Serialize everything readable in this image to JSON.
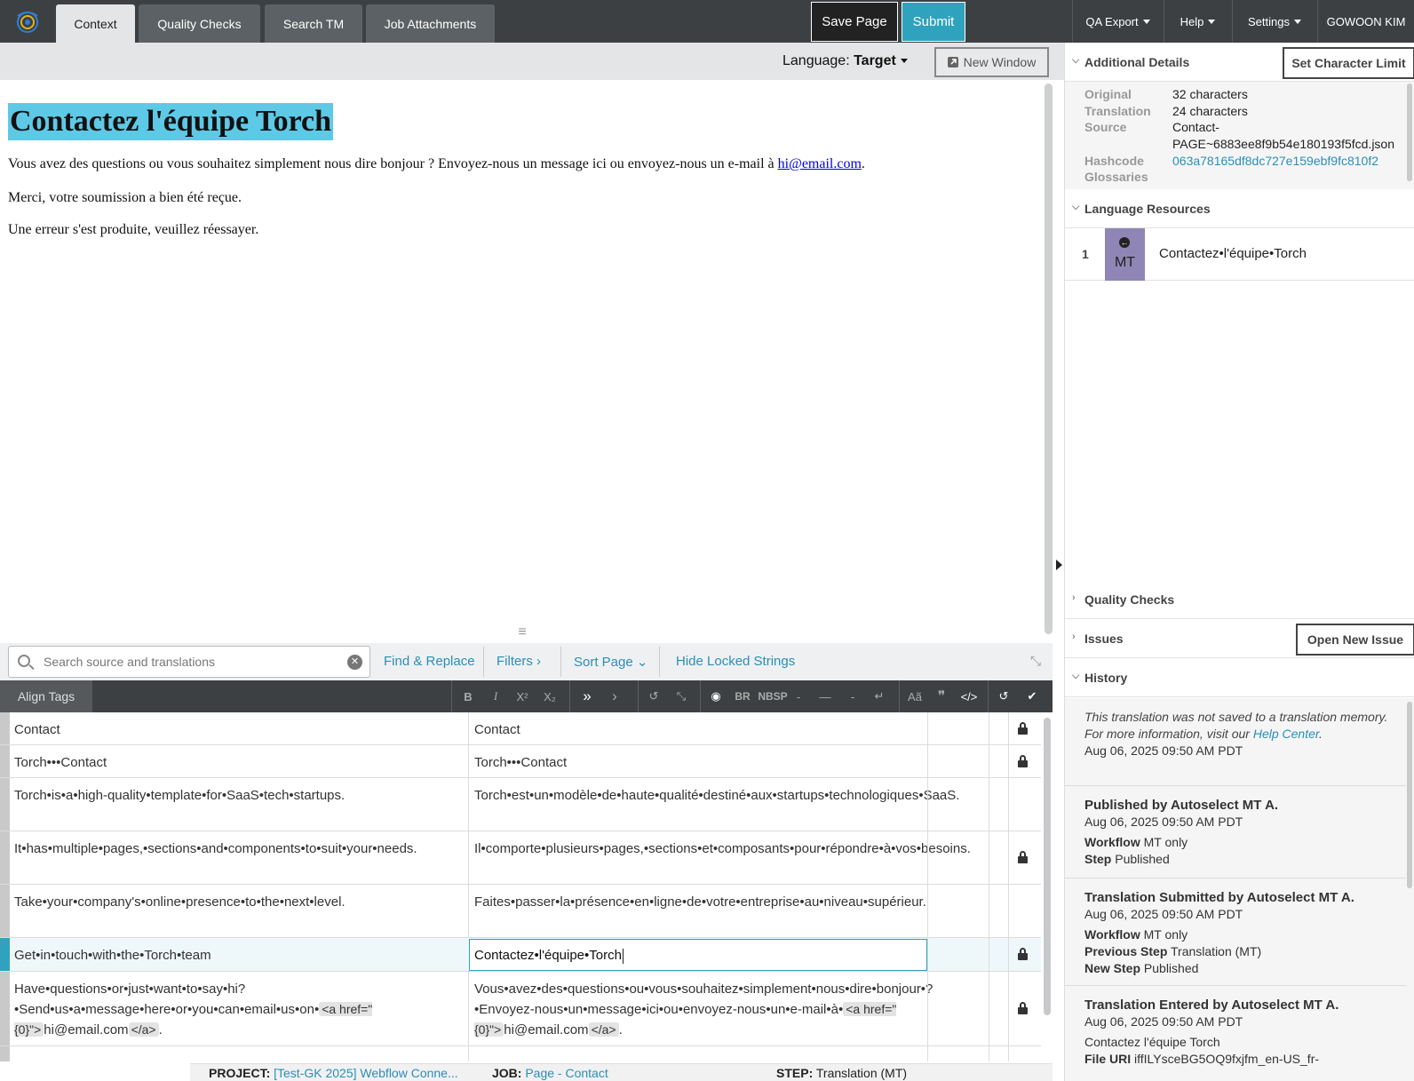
{
  "topbar": {
    "tabs": [
      "Context",
      "Quality Checks",
      "Search TM",
      "Job Attachments"
    ],
    "save_label": "Save Page",
    "submit_label": "Submit",
    "menus": [
      "QA Export",
      "Help",
      "Settings",
      "GOWOON KIM"
    ]
  },
  "preview": {
    "language_label": "Language:",
    "language_value": "Target",
    "new_window_label": "New Window",
    "heading": "Contactez l'équipe Torch",
    "p1_text": "Vous avez des questions ou vous souhaitez simplement nous dire bonjour ? Envoyez-nous un message ici ou envoyez-nous un e-mail à ",
    "p1_link": "hi@email.com",
    "p1_end": ".",
    "p2": "Merci, votre soumission a bien été reçue.",
    "p3": "Une erreur s'est produite, veuillez réessayer."
  },
  "search": {
    "placeholder": "Search source and translations",
    "find_replace": "Find & Replace",
    "filters": "Filters",
    "sort_page": "Sort Page",
    "hide_locked": "Hide Locked Strings"
  },
  "toolbar": {
    "align_tags": "Align Tags",
    "bold": "B",
    "italic": "I",
    "sup": "X²",
    "sub": "X₂",
    "br": "BR",
    "nbsp": "NBSP"
  },
  "grid": {
    "rows": [
      {
        "source": "Contact",
        "target": "Contact"
      },
      {
        "source": "Torch•••Contact",
        "target": "Torch•••Contact"
      },
      {
        "source": "Torch•is•a•high-quality•template•for•SaaS•tech•startups.",
        "target": "Torch•est•un•modèle•de•haute•qualité•destiné•aux•startups•technologiques•SaaS."
      },
      {
        "source": "It•has•multiple•pages,•sections•and•components•to•suit•your•needs.",
        "target": "Il•comporte•plusieurs•pages,•sections•et•composants•pour•répondre•à•vos•besoins."
      },
      {
        "source": "Take•your•company's•online•presence•to•the•next•level.",
        "target": "Faites•passer•la•présence•en•ligne•de•votre•entreprise•au•niveau•supérieur."
      },
      {
        "source": "Get•in•touch•with•the•Torch•team",
        "target": "Contactez•l'équipe•Torch"
      },
      {
        "source_a": "Have•questions•or•just•want•to•say•hi?•Send•us•a•message•here•or•you•can•email•us•on•",
        "source_tag1": "<a href=\"{0}\">",
        "source_b": "hi@email.com",
        "source_tag2": "</a>",
        "source_c": ".",
        "target_a": "Vous•avez•des•questions•ou•vous•souhaitez•simplement•nous•dire•bonjour•?•Envoyez-nous•un•message•ici•ou•envoyez-nous•un•e-mail•à•",
        "target_tag1": "<a href=\"{0}\">",
        "target_b": "hi@email.com",
        "target_tag2": "</a>",
        "target_c": "."
      }
    ]
  },
  "footer": {
    "project_label": "PROJECT:",
    "project_value": "[Test-GK 2025] Webflow Conne...",
    "job_label": "JOB:",
    "job_value": "Page - Contact",
    "step_label": "STEP:",
    "step_value": "Translation (MT)"
  },
  "right": {
    "additional_details": "Additional Details",
    "set_char_limit": "Set Character Limit",
    "details": {
      "original_label": "Original",
      "original_value": "32 characters",
      "translation_label": "Translation",
      "translation_value": "24 characters",
      "source_label": "Source",
      "source_value_1": "Contact-",
      "source_value_2": "PAGE~6883ee8f9b54e180193f5fcd.json",
      "hashcode_label": "Hashcode",
      "hashcode_value": "063a78165df8dc727e159ebf9fc810f2",
      "glossaries_label": "Glossaries"
    },
    "language_resources": "Language Resources",
    "lr_num": "1",
    "lr_type": "MT",
    "lr_text": "Contactez•l'équipe•Torch",
    "quality_checks": "Quality Checks",
    "issues": "Issues",
    "open_new_issue": "Open New Issue",
    "history": "History",
    "history_items": [
      {
        "note_a": "This translation was not saved to a translation memory. For more information, visit our ",
        "note_link": "Help Center",
        "note_end": ".",
        "date": "Aug 06, 2025 09:50 AM PDT"
      },
      {
        "title": "Published by Autoselect MT A.",
        "date": "Aug 06, 2025 09:50 AM PDT",
        "l1": "Workflow",
        "v1": "MT only",
        "l2": "Step",
        "v2": "Published"
      },
      {
        "title": "Translation Submitted by Autoselect MT A.",
        "date": "Aug 06, 2025 09:50 AM PDT",
        "l1": "Workflow",
        "v1": "MT only",
        "l2": "Previous Step",
        "v2": "Translation (MT)",
        "l3": "New Step",
        "v3": "Published"
      },
      {
        "title": "Translation Entered by Autoselect MT A.",
        "date": "Aug 06, 2025 09:50 AM PDT",
        "text": "Contactez l'équipe Torch",
        "l1": "File URI",
        "v1": "iffILYsceBG5OQ9fxjfm_en-US_fr-"
      }
    ]
  },
  "colors": {
    "accent": "#2fa3bd",
    "topbar": "#3d4043",
    "highlight": "#5ec9e6",
    "mt_badge": "#8f86b5"
  }
}
